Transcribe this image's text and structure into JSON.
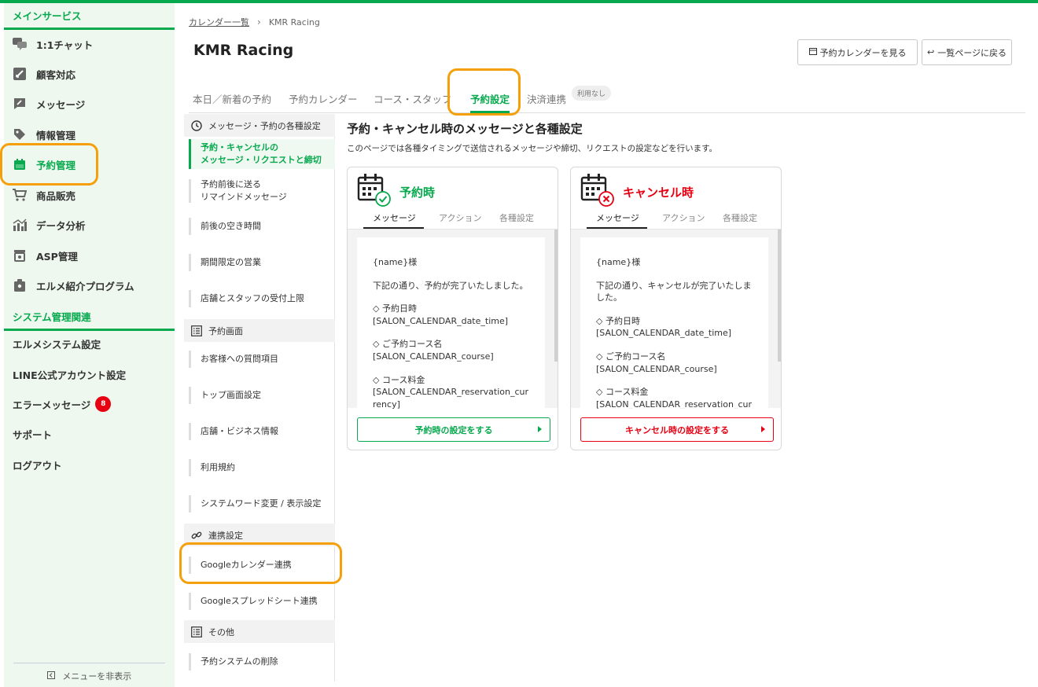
{
  "sidebar": {
    "main_section": "メインサービス",
    "items": [
      {
        "label": "1:1チャット",
        "icon": "chat-icon"
      },
      {
        "label": "顧客対応",
        "icon": "pencil-box-icon"
      },
      {
        "label": "メッセージ",
        "icon": "message-edit-icon"
      },
      {
        "label": "情報管理",
        "icon": "tag-icon"
      },
      {
        "label": "予約管理",
        "icon": "calendar-icon"
      },
      {
        "label": "商品販売",
        "icon": "cart-icon"
      },
      {
        "label": "データ分析",
        "icon": "chart-icon"
      },
      {
        "label": "ASP管理",
        "icon": "box-icon"
      },
      {
        "label": "エルメ紹介プログラム",
        "icon": "badge-icon"
      }
    ],
    "system_section": "システム管理関連",
    "system_items": [
      {
        "label": "エルメシステム設定"
      },
      {
        "label": "LINE公式アカウント設定"
      },
      {
        "label": "エラーメッセージ",
        "badge": "8"
      },
      {
        "label": "サポート"
      },
      {
        "label": "ログアウト"
      }
    ],
    "hide_menu": "メニューを非表示"
  },
  "breadcrumb": {
    "parent": "カレンダー一覧",
    "current": "KMR Racing"
  },
  "page": {
    "title": "KMR Racing"
  },
  "header_buttons": {
    "view_calendar": "予約カレンダーを見る",
    "back": "一覧ページに戻る"
  },
  "tabs": [
    {
      "label": "本日／新着の予約"
    },
    {
      "label": "予約カレンダー"
    },
    {
      "label": "コース・スタッフ"
    },
    {
      "label": "予約設定"
    },
    {
      "label": "決済連携"
    }
  ],
  "tab_pill": "利用なし",
  "submenu": {
    "groups": [
      {
        "label": "メッセージ・予約の各種設定"
      },
      {
        "label": "予約画面"
      },
      {
        "label": "連携設定"
      },
      {
        "label": "その他"
      }
    ],
    "items": [
      {
        "label": "予約・キャンセルの\nメッセージ・リクエストと締切"
      },
      {
        "label": "予約前後に送る\nリマインドメッセージ"
      },
      {
        "label": "前後の空き時間"
      },
      {
        "label": "期間限定の営業"
      },
      {
        "label": "店舗とスタッフの受付上限"
      },
      {
        "label": "お客様への質問項目"
      },
      {
        "label": "トップ画面設定"
      },
      {
        "label": "店舗・ビジネス情報"
      },
      {
        "label": "利用規約"
      },
      {
        "label": "システムワード変更 / 表示設定"
      },
      {
        "label": "Googleカレンダー連携"
      },
      {
        "label": "Googleスプレッドシート連携"
      },
      {
        "label": "予約システムの削除"
      }
    ]
  },
  "content": {
    "title": "予約・キャンセル時のメッセージと各種設定",
    "description": "このページでは各種タイミングで送信されるメッセージや締切、リクエストの設定などを行います。"
  },
  "card_tabs": [
    "メッセージ",
    "アクション",
    "各種設定"
  ],
  "cards": [
    {
      "title": "予約時",
      "color": "#06a94d",
      "message": [
        "{name}様",
        "下記の通り、予約が完了いたしました。",
        "◇ 予約日時\n[SALON_CALENDAR_date_time]",
        "◇ ご予約コース名\n[SALON_CALENDAR_course]",
        "◇ コース料金\n[SALON_CALENDAR_reservation_currency]"
      ],
      "button": "予約時の設定をする"
    },
    {
      "title": "キャンセル時",
      "color": "#e60012",
      "message": [
        "{name}様",
        "下記の通り、キャンセルが完了いたしました。",
        "◇ 予約日時\n[SALON_CALENDAR_date_time]",
        "◇ ご予約コース名\n[SALON_CALENDAR_course]",
        "◇ コース料金\n[SALON_CALENDAR_reservation_currency]"
      ],
      "button": "キャンセル時の設定をする"
    }
  ],
  "colors": {
    "brand": "#06a94d",
    "danger": "#e60012",
    "highlight": "#f5a00b"
  }
}
